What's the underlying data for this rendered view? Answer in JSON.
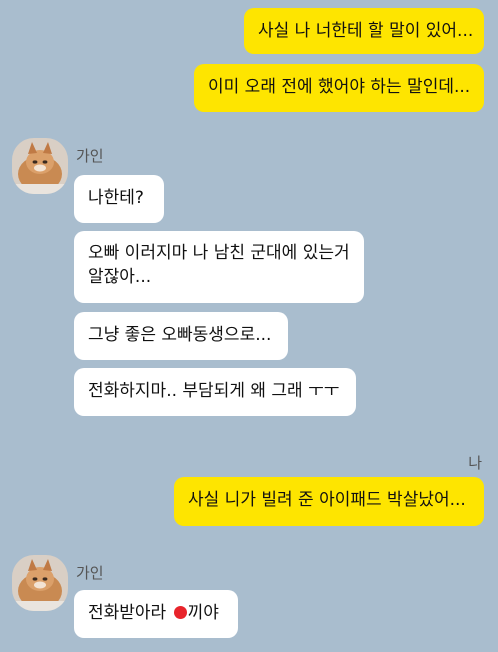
{
  "chat": {
    "contact_name": "가인",
    "me_name": "나",
    "messages": [
      {
        "sender": "me",
        "text": "사실 나 너한테 할 말이 있어..."
      },
      {
        "sender": "me",
        "text": "이미 오래 전에 했어야 하는 말인데..."
      },
      {
        "sender": "them",
        "text": "나한테?"
      },
      {
        "sender": "them",
        "lines": [
          "오빠 이러지마 나 남친 군대에 있는거",
          "알잖아..."
        ]
      },
      {
        "sender": "them",
        "text": "그냥 좋은 오빠동생으로..."
      },
      {
        "sender": "them",
        "text": "전화하지마.. 부담되게 왜 그래 ㅜㅜ"
      },
      {
        "sender": "me",
        "text": "사실 니가 빌려 준 아이패드 박살났어..."
      },
      {
        "sender": "them",
        "text_before": "전화받아라 ",
        "text_after": "끼야"
      }
    ]
  },
  "colors": {
    "background": "#a9bdce",
    "my_bubble": "#fee500",
    "their_bubble": "#ffffff",
    "censor_dot": "#e8242b"
  }
}
